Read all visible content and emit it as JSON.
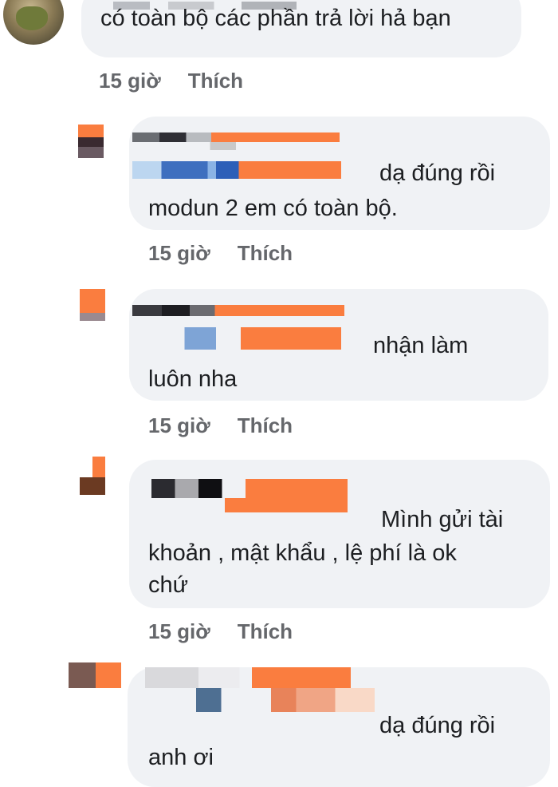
{
  "comments": [
    {
      "text_lines": [
        "có toàn bộ các phần trả lời  hả bạn"
      ],
      "time": "15 giờ",
      "like_label": "Thích"
    },
    {
      "text_lines": [
        "dạ đúng rồi",
        "modun 2 em có toàn bộ."
      ],
      "time": "15 giờ",
      "like_label": "Thích"
    },
    {
      "text_lines": [
        "nhận làm",
        "luôn nha"
      ],
      "time": "15 giờ",
      "like_label": "Thích"
    },
    {
      "text_lines": [
        "Mình gửi tài",
        "khoản , mật  khẩu , lệ phí là  ok",
        "chứ"
      ],
      "time": "15 giờ",
      "like_label": "Thích"
    },
    {
      "text_lines": [
        "dạ đúng rồi",
        "anh ơi"
      ]
    }
  ],
  "colors": {
    "bubble_bg": "#f0f2f5",
    "meta_text": "#65676b",
    "censor_orange": "#fa7d3f"
  }
}
